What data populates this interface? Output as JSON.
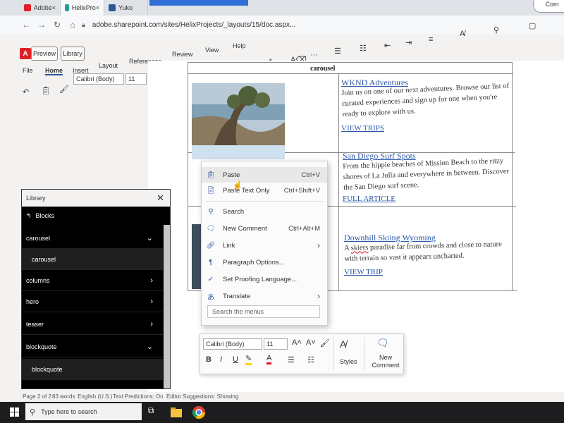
{
  "browser": {
    "tabs": [
      {
        "label": "Adobe",
        "close": "×"
      },
      {
        "label": "HelixPro",
        "close": "×"
      },
      {
        "label": "Yuko",
        "close": ""
      }
    ],
    "url": "adobe.sharepoint.com/sites/HelixProjects/_layouts/15/doc.aspx...",
    "comment_label": "Com"
  },
  "word": {
    "preview_label": "Preview",
    "library_label": "Library",
    "menus": [
      "File",
      "Home",
      "Insert",
      "Layout",
      "References",
      "Review",
      "View",
      "Help"
    ],
    "active_menu": "Home",
    "font_name": "Calibri (Body)",
    "font_size": "11"
  },
  "document": {
    "table_caption": "carousel",
    "rows": [
      {
        "title": "WKND Adventures",
        "text": "Join us on one of our next adventures. Browse our list of curated experiences and sign up for one when you're ready to explore with us.",
        "cta": "VIEW TRIPS"
      },
      {
        "title": "San Diego Surf Spots",
        "text": "From the hippie beaches of Mission Beach to the ritzy shores of La Jolla and everywhere in between. Discover the San Diego surf scene.",
        "cta": "FULL ARTICLE"
      },
      {
        "title": "Downhill Skiing Wyoming",
        "text_word": "skiers",
        "text_before": "A ",
        "text_after": " paradise far from crowds and close to nature with terrain so vast it appears uncharted.",
        "cta": "VIEW TRIP"
      }
    ]
  },
  "context_menu": {
    "items": [
      {
        "label": "Paste",
        "shortcut": "Ctrl+V",
        "icon": "clipboard-icon"
      },
      {
        "label": "Paste Text Only",
        "shortcut": "Ctrl+Shift+V",
        "icon": "paste-text-icon"
      },
      {
        "label": "Search",
        "shortcut": "",
        "icon": "search-icon"
      },
      {
        "label": "New Comment",
        "shortcut": "Ctrl+Alt+M",
        "icon": "comment-icon"
      },
      {
        "label": "Link",
        "shortcut": "",
        "icon": "link-icon"
      },
      {
        "label": "Paragraph Options...",
        "shortcut": "",
        "icon": "paragraph-icon"
      },
      {
        "label": "Set Proofing Language...",
        "shortcut": "",
        "icon": "proofing-icon"
      },
      {
        "label": "Translate",
        "shortcut": "",
        "icon": "translate-icon"
      }
    ],
    "search_placeholder": "Search the menus"
  },
  "mini_toolbar": {
    "font_name": "Calibri (Body)",
    "font_size": "11",
    "styles_label": "Styles",
    "new_comment_label": "New\nComment"
  },
  "library_panel": {
    "title": "Library",
    "section": "Blocks",
    "items": [
      {
        "label": "carousel",
        "expanded": true
      },
      {
        "label": "carousel",
        "sub": true
      },
      {
        "label": "columns",
        "expanded": false
      },
      {
        "label": "hero",
        "expanded": false
      },
      {
        "label": "teaser",
        "expanded": false
      },
      {
        "label": "blockquote",
        "expanded": true
      },
      {
        "label": "blockquote",
        "sub": true
      }
    ]
  },
  "status_bar": {
    "page": "Page 2 of 2",
    "words": "83 words",
    "language": "English (U.S.)",
    "predictions": "Text Predictions: On",
    "editor": "Editor Suggestions: Showing"
  },
  "taskbar": {
    "search_placeholder": "Type here to search"
  }
}
